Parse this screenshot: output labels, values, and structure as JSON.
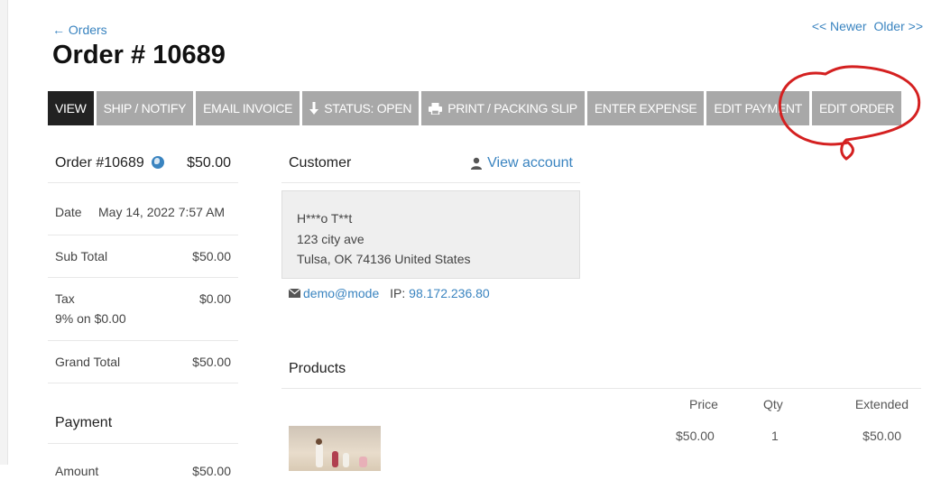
{
  "nav": {
    "back_label": "← Orders",
    "newer_label": "<< Newer",
    "older_label": "Older >>"
  },
  "page_title": "Order # 10689",
  "toolbar": [
    {
      "label": "VIEW",
      "active": true,
      "icon": ""
    },
    {
      "label": "SHIP / NOTIFY",
      "icon": ""
    },
    {
      "label": "EMAIL INVOICE",
      "icon": ""
    },
    {
      "label": "STATUS: OPEN",
      "icon": "download-arrow-icon"
    },
    {
      "label": "PRINT / PACKING SLIP",
      "icon": "printer-icon"
    },
    {
      "label": "ENTER EXPENSE",
      "icon": ""
    },
    {
      "label": "EDIT PAYMENT",
      "icon": ""
    },
    {
      "label": "EDIT ORDER",
      "icon": ""
    }
  ],
  "annotation": {
    "color": "#d42020",
    "shape": "hand-drawn circle around EDIT ORDER"
  },
  "summary": {
    "order_label": "Order #10689",
    "order_total": "$50.00",
    "date_label": "Date",
    "date_value": "May 14, 2022 7:57 AM",
    "subtotal_label": "Sub Total",
    "subtotal_value": "$50.00",
    "tax_label": "Tax",
    "tax_value": "$0.00",
    "tax_note": "9% on $0.00",
    "grand_total_label": "Grand Total",
    "grand_total_value": "$50.00",
    "payment_heading": "Payment",
    "amount_label": "Amount",
    "amount_value": "$50.00"
  },
  "customer": {
    "heading": "Customer",
    "view_account": "View account",
    "name": "H***o T**t",
    "street": "123 city ave",
    "city_line": "Tulsa, OK 74136 United States",
    "email": "demo@mode",
    "ip_label": "IP:",
    "ip_value": "98.172.236.80"
  },
  "products": {
    "heading": "Products",
    "columns": {
      "price": "Price",
      "qty": "Qty",
      "extended": "Extended"
    },
    "rows": [
      {
        "price": "$50.00",
        "qty": "1",
        "extended": "$50.00"
      }
    ]
  },
  "colors": {
    "link": "#3a84c0",
    "button": "#a8a8a8",
    "button_active": "#222222"
  }
}
